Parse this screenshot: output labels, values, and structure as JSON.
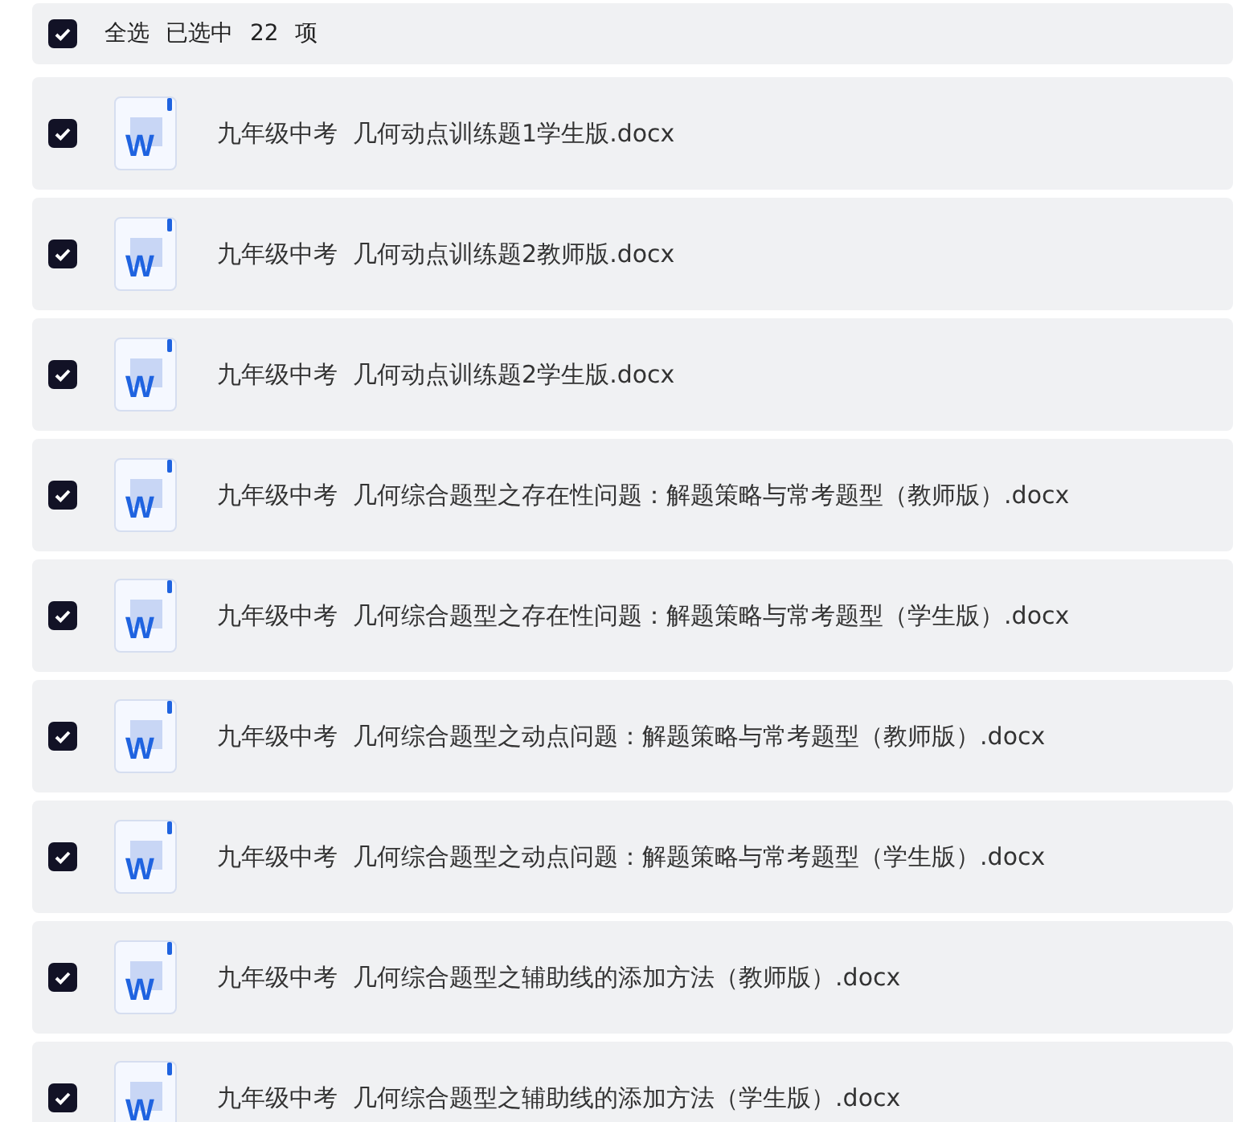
{
  "header": {
    "checked": true,
    "label": "全选",
    "summary": "已选中 22 项"
  },
  "files": [
    {
      "checked": true,
      "icon_letter": "W",
      "name": "九年级中考  几何动点训练题1学生版.docx"
    },
    {
      "checked": true,
      "icon_letter": "W",
      "name": "九年级中考  几何动点训练题2教师版.docx"
    },
    {
      "checked": true,
      "icon_letter": "W",
      "name": "九年级中考  几何动点训练题2学生版.docx"
    },
    {
      "checked": true,
      "icon_letter": "W",
      "name": "九年级中考  几何综合题型之存在性问题：解题策略与常考题型（教师版）.docx"
    },
    {
      "checked": true,
      "icon_letter": "W",
      "name": "九年级中考  几何综合题型之存在性问题：解题策略与常考题型（学生版）.docx"
    },
    {
      "checked": true,
      "icon_letter": "W",
      "name": "九年级中考  几何综合题型之动点问题：解题策略与常考题型（教师版）.docx"
    },
    {
      "checked": true,
      "icon_letter": "W",
      "name": "九年级中考  几何综合题型之动点问题：解题策略与常考题型（学生版）.docx"
    },
    {
      "checked": true,
      "icon_letter": "W",
      "name": "九年级中考  几何综合题型之辅助线的添加方法（教师版）.docx"
    },
    {
      "checked": true,
      "icon_letter": "W",
      "name": "九年级中考  几何综合题型之辅助线的添加方法（学生版）.docx"
    }
  ]
}
